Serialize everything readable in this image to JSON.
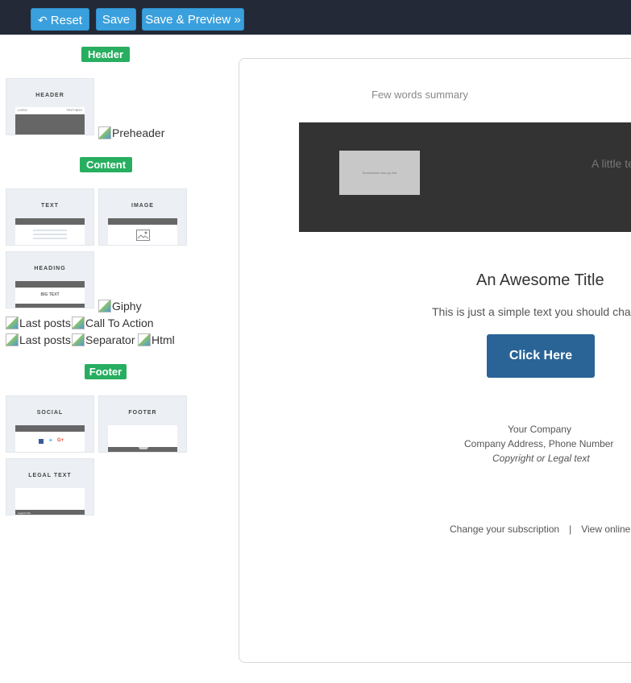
{
  "toolbar": {
    "reset_label": "Reset",
    "save_label": "Save",
    "preview_label": "Save & Preview »"
  },
  "sidebar": {
    "header_label": "Header",
    "content_label": "Content",
    "footer_label": "Footer",
    "blocks": {
      "header": {
        "title": "HEADER",
        "logo": "LOGO",
        "tagline": "TEXT BOX"
      },
      "text": {
        "title": "TEXT"
      },
      "image": {
        "title": "IMAGE"
      },
      "heading": {
        "title": "HEADING",
        "big": "BIG TEXT"
      },
      "social": {
        "title": "SOCIAL"
      },
      "footer": {
        "title": "FOOTER"
      },
      "legal": {
        "title": "LEGAL TEXT",
        "small": "Legal & Info"
      }
    },
    "broken": {
      "preheader": "Preheader",
      "giphy": "Giphy",
      "last_posts_1": "Last posts",
      "call_to_action": "Call To Action",
      "last_posts_2": "Last posts",
      "separator": "Separator",
      "html": "Html"
    }
  },
  "preview": {
    "summary": "Few words summary",
    "logo_placeholder": "Somewhere else go link",
    "hero_text": "A little te",
    "title": "An Awesome Title",
    "intro": "This is just a simple text you should cha",
    "cta": "Click Here",
    "company": "Your Company",
    "address": "Company Address, Phone Number",
    "copyright": "Copyright or Legal text",
    "link_subscription": "Change your subscription",
    "separator": "|",
    "link_online": "View online"
  },
  "colors": {
    "topbar": "#232937",
    "button": "#3aa0dd",
    "section_label": "#27ae60",
    "cta": "#2a6496",
    "hero": "#333333"
  }
}
